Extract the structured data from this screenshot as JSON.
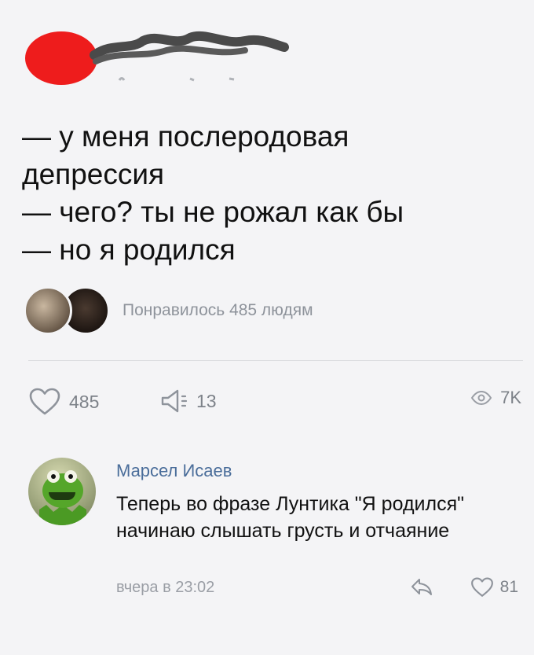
{
  "post": {
    "text": "— у меня послеродовая\nдепрессия\n— чего? ты не рожал как бы\n— но я родился",
    "liked_by_text": "Понравилось 485 людям",
    "actions": {
      "likes": "485",
      "shares": "13",
      "views": "7K"
    }
  },
  "comment": {
    "author": "Марсел Исаев",
    "text": "Теперь во фразе Лунтика \"Я родился\" начинаю слышать грусть и отчаяние",
    "time": "вчера в 23:02",
    "likes": "81"
  },
  "colors": {
    "background": "#f4f4f6",
    "link": "#4a6d9a",
    "muted": "#8e939b",
    "censor_red": "#ee1c1c"
  }
}
